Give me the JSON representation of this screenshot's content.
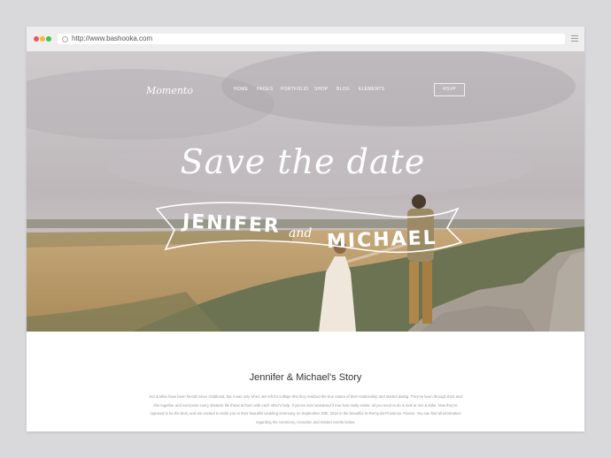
{
  "browser": {
    "url": "http://www.bashooka.com"
  },
  "site": {
    "logo": "Momento",
    "nav": [
      "HOME",
      "PAGES",
      "PORTFOLIO",
      "SHOP",
      "BLOG",
      "ELEMENTS"
    ],
    "rsvp": "RSVP"
  },
  "hero": {
    "script_title": "Save the date",
    "name1": "JENIFER",
    "and": "and",
    "name2": "MICHAEL"
  },
  "story": {
    "title": "Jennifer & Michael's Story",
    "body": "Jen & Mike have been friends since childhood, but it was only when Jen left for college that they realized the true nature of their relationship and started dating. They've been through thick and thin together and overcame every obstacle life threw at them with each other's help. If you've ever wondered if true love really exists, all you need to do is look at Jen & Mike. Now they're opposed to be the best, and are excited to invite you to their beautiful wedding ceremony on September 20th, 2018 in the beautiful St-Remy-de-Provence, France. You can find all information regarding the ceremony, reception and related events below."
  },
  "colors": {
    "sky": "#c9c4c6",
    "field": "#b79968",
    "hills": "#6b7a52",
    "rocks": "#a9a39a"
  }
}
